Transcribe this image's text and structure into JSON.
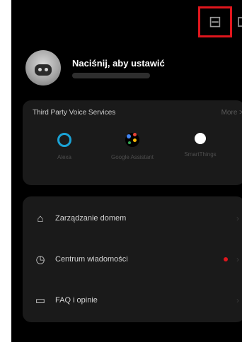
{
  "header": {
    "icon": "layout-icon",
    "glyph": "⊟",
    "highlight_color": "#e0161d"
  },
  "profile": {
    "title": "Naciśnij, aby ustawić"
  },
  "voice": {
    "title": "Third Party Voice Services",
    "more": "More >",
    "services": [
      {
        "label": "Alexa",
        "icon": "alexa-icon"
      },
      {
        "label": "Google Assistant",
        "icon": "google-assistant-icon"
      },
      {
        "label": "SmartThings",
        "icon": "smartthings-icon"
      }
    ]
  },
  "menu": {
    "items": [
      {
        "label": "Zarządzanie domem",
        "icon": "home-icon",
        "glyph": "⌂"
      },
      {
        "label": "Centrum wiadomości",
        "icon": "clock-icon",
        "glyph": "◷"
      },
      {
        "label": "FAQ i opinie",
        "icon": "message-icon",
        "glyph": "▭"
      }
    ],
    "chevron": "›"
  },
  "colors": {
    "background": "#000000",
    "card": "#1a1a1a",
    "alexa": "#1aa3d6",
    "badge": "#e0161d"
  }
}
